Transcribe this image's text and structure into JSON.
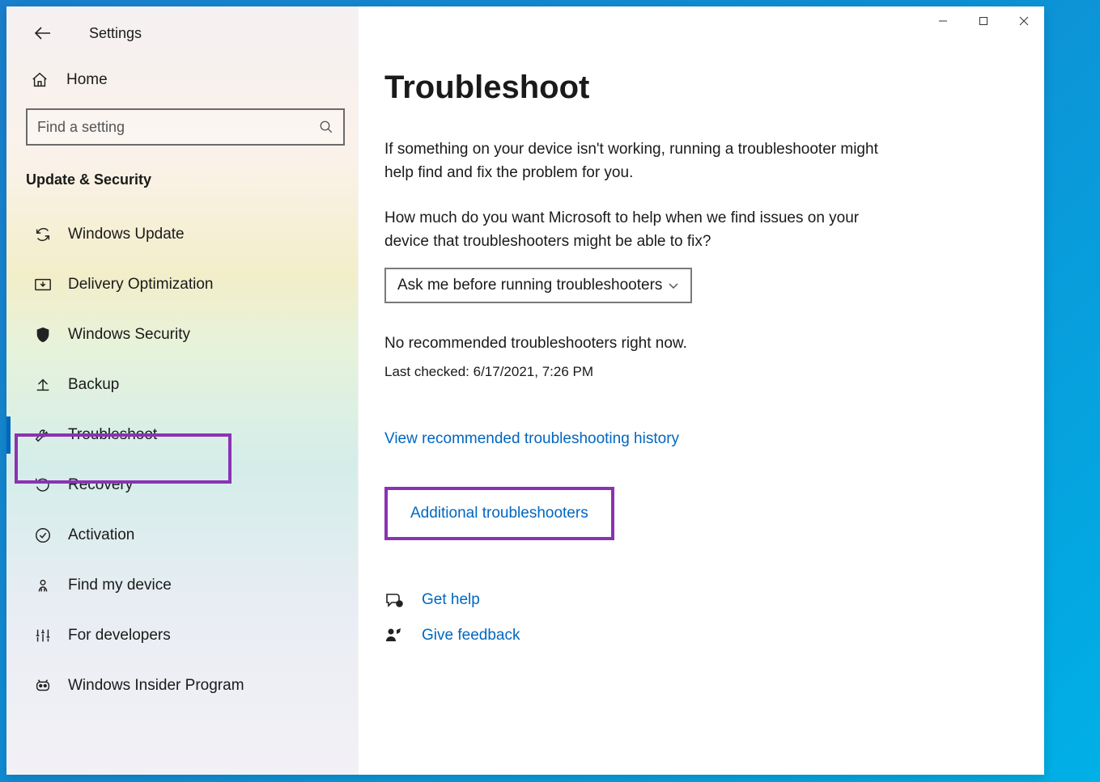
{
  "app": {
    "title": "Settings"
  },
  "sidebar": {
    "home_label": "Home",
    "search_placeholder": "Find a setting",
    "section": "Update & Security",
    "items": [
      {
        "label": "Windows Update"
      },
      {
        "label": "Delivery Optimization"
      },
      {
        "label": "Windows Security"
      },
      {
        "label": "Backup"
      },
      {
        "label": "Troubleshoot"
      },
      {
        "label": "Recovery"
      },
      {
        "label": "Activation"
      },
      {
        "label": "Find my device"
      },
      {
        "label": "For developers"
      },
      {
        "label": "Windows Insider Program"
      }
    ]
  },
  "page": {
    "title": "Troubleshoot",
    "description": "If something on your device isn't working, running a troubleshooter might help find and fix the problem for you.",
    "prompt": "How much do you want Microsoft to help when we find issues on your device that troubleshooters might be able to fix?",
    "dropdown_value": "Ask me before running troubleshooters",
    "no_recommended": "No recommended troubleshooters right now.",
    "last_checked": "Last checked: 6/17/2021, 7:26 PM",
    "history_link": "View recommended troubleshooting history",
    "additional_link": "Additional troubleshooters",
    "get_help": "Get help",
    "give_feedback": "Give feedback"
  }
}
